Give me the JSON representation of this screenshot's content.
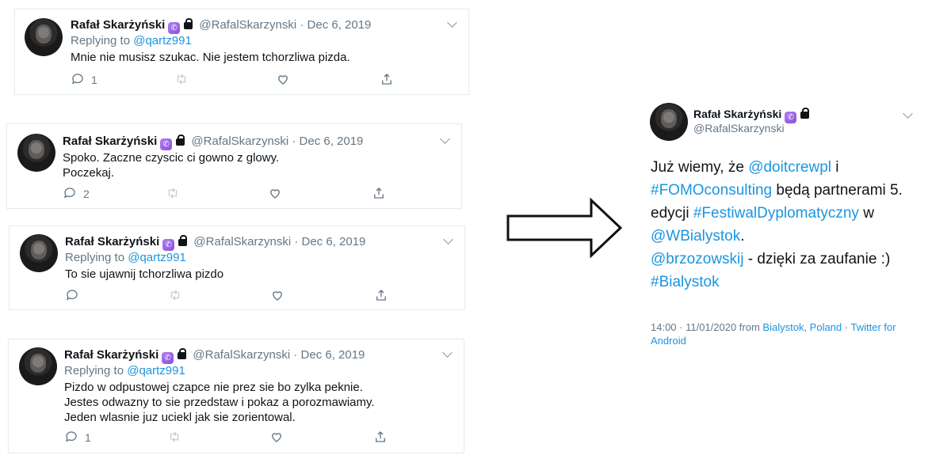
{
  "author": {
    "name": "Rafał Skarżyński",
    "handle": "@RafalSkarzynski"
  },
  "replying_prefix": "Replying to",
  "tweets": [
    {
      "date": "Dec 6, 2019",
      "reply_to": "@qartz991",
      "text": "Mnie nie musisz szukac. Nie jestem tchorzliwa pizda.",
      "replies": "1"
    },
    {
      "date": "Dec 6, 2019",
      "text": "Spoko. Zaczne czyscic ci gowno z glowy.\nPoczekaj.",
      "replies": "2"
    },
    {
      "date": "Dec 6, 2019",
      "reply_to": "@qartz991",
      "text": "To sie ujawnij tchorzliwa pizdo",
      "replies": ""
    },
    {
      "date": "Dec 6, 2019",
      "reply_to": "@qartz991",
      "text": "Pizdo w odpustowej czapce nie prez sie bo zylka peknie.\nJestes odwazny to sie przedstaw i pokaz a porozmawiamy.\nJeden wlasnie juz uciekl jak sie zorientowal.",
      "replies": "1"
    }
  ],
  "main_tweet": {
    "text_parts": [
      {
        "t": "Już wiemy, że ",
        "link": false
      },
      {
        "t": "@doitcrewpl",
        "link": true
      },
      {
        "t": " i ",
        "link": false
      },
      {
        "t": "#FOMOconsulting",
        "link": true
      },
      {
        "t": " będą partnerami 5. edycji ",
        "link": false
      },
      {
        "t": "#FestiwalDyplomatyczny",
        "link": true
      },
      {
        "t": " w ",
        "link": false
      },
      {
        "t": "@WBialystok",
        "link": true
      },
      {
        "t": ".",
        "link": false
      },
      {
        "t": "@brzozowskij",
        "link": true
      },
      {
        "t": " - dzięki za zaufanie :)",
        "link": false
      },
      {
        "t": "#Bialystok",
        "link": true
      }
    ],
    "time": "14:00 · 11/01/2020 from ",
    "location": "Bialystok, Poland",
    "separator": " · ",
    "source": "Twitter for Android"
  },
  "colors": {
    "link": "#1b95e0",
    "meta": "#657786",
    "badge": "#9b5de5"
  },
  "icons": [
    "reply-icon",
    "retweet-icon",
    "like-icon",
    "share-icon",
    "chevron-down-icon",
    "lock-icon",
    "verified-badge-icon",
    "right-arrow"
  ]
}
